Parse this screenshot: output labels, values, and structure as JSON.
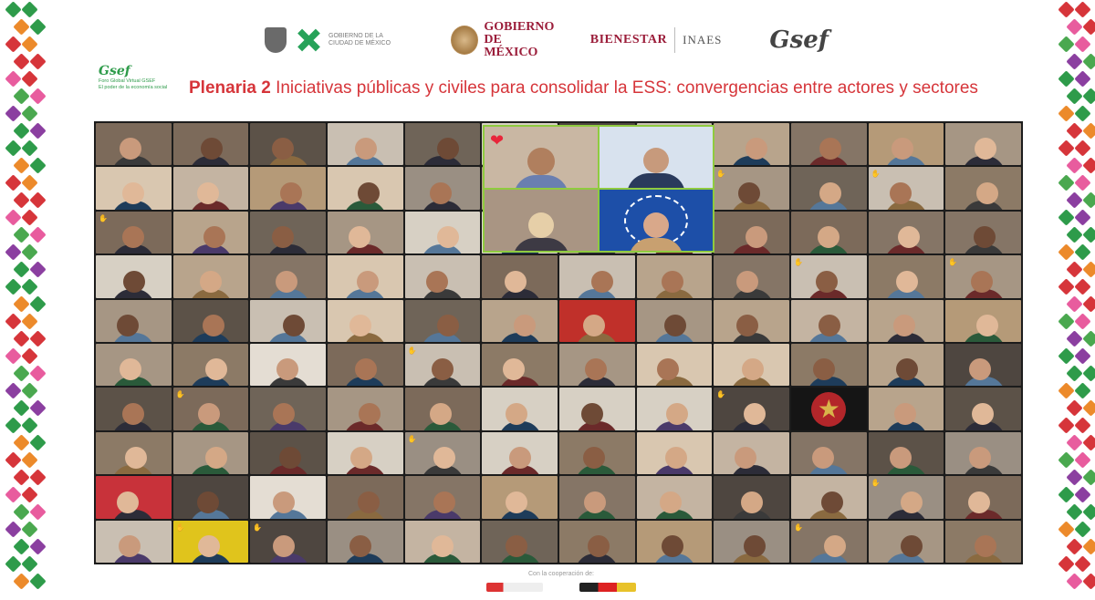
{
  "header": {
    "logos": {
      "cdmx": "GOBIERNO DE LA CIUDAD DE MÉXICO",
      "gobierno_line1": "GOBIERNO DE",
      "gobierno_line2": "MÉXICO",
      "bienestar": "BIENESTAR",
      "inaes": "INAES",
      "gsef": "Gsef"
    },
    "forum_logo": {
      "gsef": "Gsef",
      "line1": "Foro Global Virtual GSEF",
      "line2": "El poder de la economía social"
    },
    "title": {
      "prefix": "Plenaria 2",
      "text": "Iniciativas públicas y civiles para consolidar la ESS: convergencias entre actores y sectores"
    }
  },
  "colors": {
    "title": "#d6353a",
    "spotlight_border": "#8fcb3f",
    "gallery_background": "#1c1c1c",
    "gobierno_red": "#9b1d3a"
  },
  "footer": {
    "text": "Con la cooperación de:"
  }
}
